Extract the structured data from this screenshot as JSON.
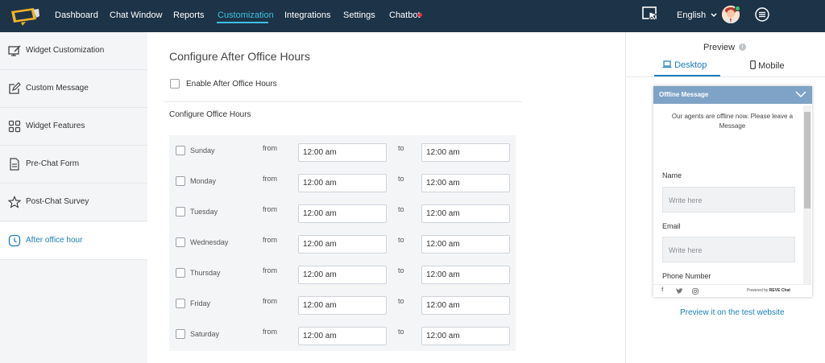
{
  "nav": {
    "items": [
      "Dashboard",
      "Chat Window",
      "Reports",
      "Customization",
      "Integrations",
      "Settings",
      "Chatbot"
    ],
    "active": "Customization",
    "language": "English",
    "accent_color": "#3ec0e0",
    "background_color": "#1d3347"
  },
  "sidebar": {
    "items": [
      {
        "label": "Widget Customization",
        "icon": "monitor-edit-icon"
      },
      {
        "label": "Custom Message",
        "icon": "edit-icon"
      },
      {
        "label": "Widget Features",
        "icon": "grid-icon"
      },
      {
        "label": "Pre-Chat Form",
        "icon": "document-icon"
      },
      {
        "label": "Post-Chat Survey",
        "icon": "star-icon"
      },
      {
        "label": "After office hour",
        "icon": "clock-icon"
      }
    ],
    "active": "After office hour"
  },
  "main": {
    "title": "Configure After Office Hours",
    "enable_label": "Enable After Office Hours",
    "office_hours_title": "Configure Office Hours",
    "from_label": "from",
    "to_label": "to",
    "days": [
      {
        "day": "Sunday",
        "from": "12:00 am",
        "to": "12:00 am"
      },
      {
        "day": "Monday",
        "from": "12:00 am",
        "to": "12:00 am"
      },
      {
        "day": "Tuesday",
        "from": "12:00 am",
        "to": "12:00 am"
      },
      {
        "day": "Wednesday",
        "from": "12:00 am",
        "to": "12:00 am"
      },
      {
        "day": "Thursday",
        "from": "12:00 am",
        "to": "12:00 am"
      },
      {
        "day": "Friday",
        "from": "12:00 am",
        "to": "12:00 am"
      },
      {
        "day": "Saturday",
        "from": "12:00 am",
        "to": "12:00 am"
      }
    ]
  },
  "preview": {
    "title": "Preview",
    "tabs": [
      "Desktop",
      "Mobile"
    ],
    "active_tab": "Desktop",
    "widget": {
      "header": "Offline Message",
      "message": "Our agents are offline now. Please leave a Message",
      "fields": [
        {
          "label": "Name",
          "placeholder": "Write here"
        },
        {
          "label": "Email",
          "placeholder": "Write here"
        },
        {
          "label": "Phone Number"
        }
      ],
      "powered_by": "Powered by",
      "brand": "REVE Chat",
      "header_color": "#7ea3c6"
    },
    "link": "Preview it on the test website"
  }
}
